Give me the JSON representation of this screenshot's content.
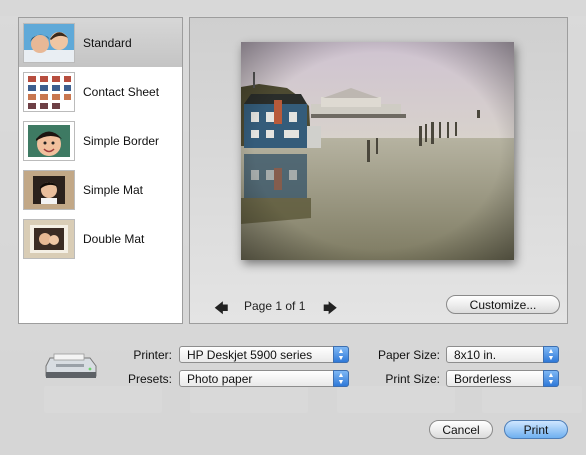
{
  "templates": [
    {
      "name": "Standard",
      "selected": true
    },
    {
      "name": "Contact Sheet",
      "selected": false
    },
    {
      "name": "Simple Border",
      "selected": false
    },
    {
      "name": "Simple Mat",
      "selected": false
    },
    {
      "name": "Double Mat",
      "selected": false
    }
  ],
  "preview": {
    "page_label": "Page 1 of 1",
    "prev_icon": "arrow-left-icon",
    "next_icon": "arrow-right-icon",
    "customize_label": "Customize..."
  },
  "settings": {
    "printer_label": "Printer:",
    "printer_value": "HP Deskjet 5900 series",
    "presets_label": "Presets:",
    "presets_value": "Photo paper",
    "paper_size_label": "Paper Size:",
    "paper_size_value": "8x10 in.",
    "print_size_label": "Print Size:",
    "print_size_value": "Borderless"
  },
  "actions": {
    "cancel_label": "Cancel",
    "print_label": "Print"
  },
  "colors": {
    "accent": "#3c7fdc",
    "selection": "#c9c9c9"
  }
}
